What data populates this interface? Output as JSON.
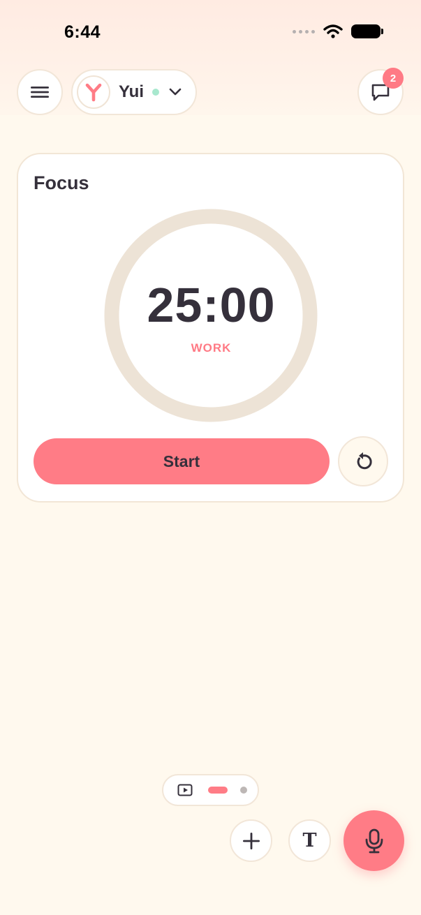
{
  "status_bar": {
    "time": "6:44"
  },
  "header": {
    "profile": {
      "name": "Yui",
      "online": true
    },
    "notifications": {
      "count": "2"
    }
  },
  "focus_card": {
    "title": "Focus",
    "timer": "25:00",
    "mode": "WORK",
    "progress": 0,
    "start_label": "Start"
  },
  "icons": {
    "menu": "menu-icon",
    "chat": "chat-bubble-icon",
    "avatar": "y-logo-icon",
    "dropdown": "chevron-down-icon",
    "reset": "reset-icon",
    "media": "play-icon",
    "add": "plus-icon",
    "text": "text-icon",
    "mic": "microphone-icon"
  },
  "colors": {
    "accent": "#FF7C86",
    "background": "#FFF9EE",
    "ring": "#EDE3D6",
    "online": "#A8E8CE",
    "text": "#35303B"
  },
  "pager": {
    "pages": 3,
    "active": 2
  },
  "toolbar": {
    "text_glyph": "T"
  }
}
